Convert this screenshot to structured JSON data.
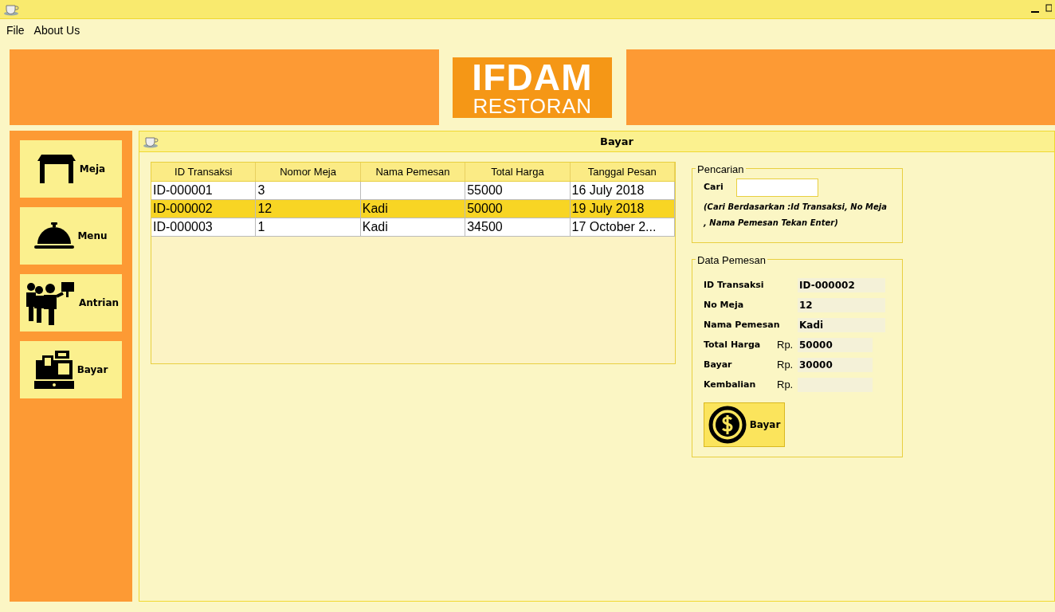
{
  "menu": [
    "File",
    "About Us"
  ],
  "logo": {
    "title": "IFDAM",
    "subtitle": "RESTORAN"
  },
  "sidebar": [
    {
      "kind": "table",
      "label": "Meja"
    },
    {
      "kind": "bell",
      "label": "Menu"
    },
    {
      "kind": "queue",
      "label": "Antrian"
    },
    {
      "kind": "register",
      "label": "Bayar"
    }
  ],
  "frame": {
    "title": "Bayar"
  },
  "table": {
    "columns": [
      "ID Transaksi",
      "Nomor Meja",
      "Nama Pemesan",
      "Total Harga",
      "Tanggal Pesan"
    ],
    "rows": [
      {
        "selected": false,
        "cells": [
          "ID-000001",
          "3",
          null,
          "55000",
          "16 July 2018"
        ]
      },
      {
        "selected": true,
        "cells": [
          "ID-000002",
          "12",
          "Kadi",
          "50000",
          "19 July 2018"
        ]
      },
      {
        "selected": false,
        "cells": [
          "ID-000003",
          "1",
          "Kadi",
          "34500",
          "17 October 2..."
        ]
      }
    ]
  },
  "search": {
    "legend": "Pencarian",
    "label": "Cari",
    "hint": "(Cari Berdasarkan :Id Transaksi, No Meja , Nama Pemesan Tekan Enter)"
  },
  "details": {
    "legend": "Data Pemesan",
    "fields": [
      {
        "label": "ID Transaksi",
        "value": "ID-000002"
      },
      {
        "label": "No Meja",
        "value": "12"
      },
      {
        "label": "Nama Pemesan",
        "value": "Kadi"
      },
      {
        "label": "Total Harga",
        "prefix": "Rp.",
        "value": "50000"
      },
      {
        "label": "Bayar",
        "prefix": "Rp.",
        "value": "30000"
      },
      {
        "label": "Kembalian",
        "prefix": "Rp."
      }
    ],
    "button": "Bayar"
  }
}
